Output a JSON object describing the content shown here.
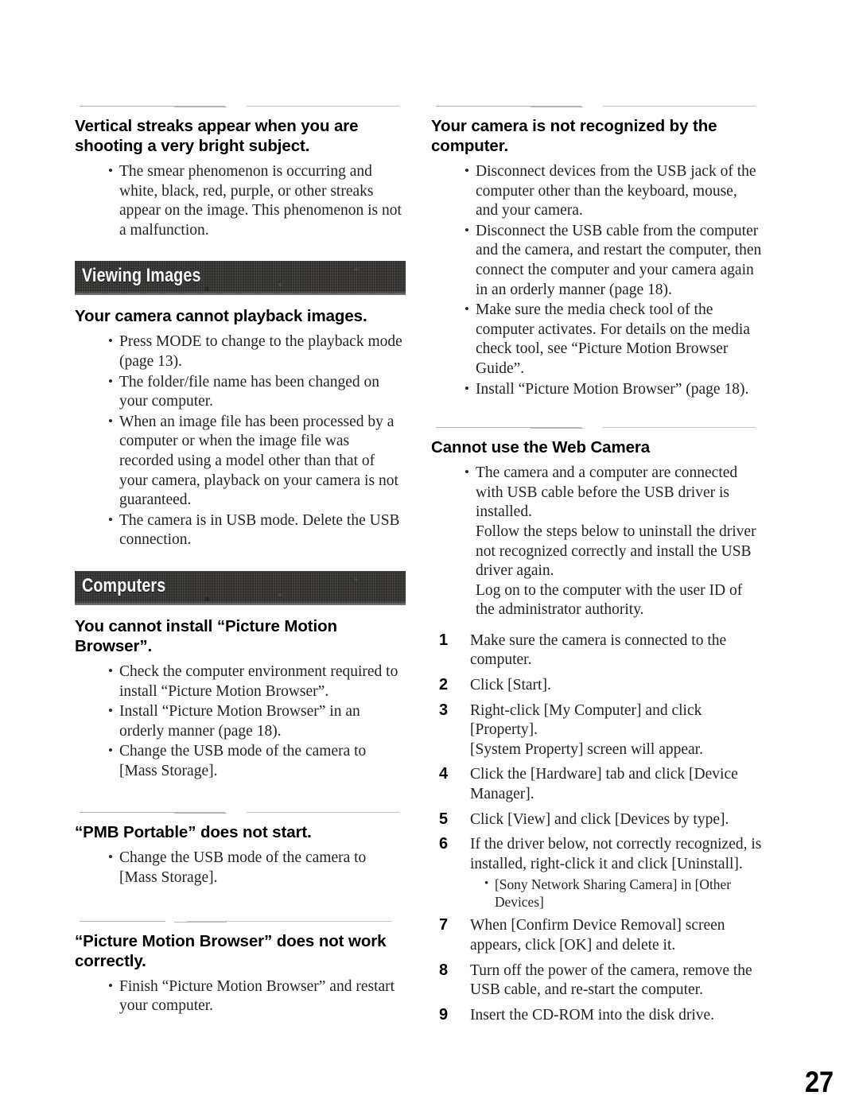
{
  "page_number": "27",
  "left_column": {
    "sections": [
      {
        "id": "vertical-streaks",
        "has_rule": true,
        "heading": "Vertical streaks appear when you are shooting a very bright subject.",
        "bullets": [
          "The smear phenomenon is occurring and white, black, red, purple, or other streaks appear on the image. This phenomenon is not a malfunction."
        ]
      }
    ],
    "banner_viewing_images": "Viewing Images",
    "viewing_images": {
      "heading": "Your camera cannot playback images.",
      "bullets": [
        "Press MODE to change to the playback mode (page 13).",
        "The folder/file name has been changed on your computer.",
        "When an image file has been processed by a computer or when the image file was recorded using a model other than that of your camera, playback on your camera is not guaranteed.",
        "The camera is in USB mode. Delete the USB connection."
      ]
    },
    "banner_computers": "Computers",
    "computers": {
      "heading": "You cannot install “Picture Motion Browser”.",
      "bullets": [
        "Check the computer environment required to install “Picture Motion Browser”.",
        "Install “Picture Motion Browser” in an orderly manner (page 18).",
        "Change the USB mode of the camera to [Mass Storage]."
      ]
    },
    "pmb_portable": {
      "heading": "“PMB Portable” does not start.",
      "bullets": [
        "Change the USB mode of the camera to [Mass Storage]."
      ]
    },
    "pmb_not_working": {
      "heading": "“Picture Motion Browser” does not work correctly.",
      "bullets": [
        "Finish “Picture Motion Browser” and restart your computer."
      ]
    }
  },
  "right_column": {
    "camera_not_recognized": {
      "heading": "Your camera is not recognized by the computer.",
      "bullets": [
        "Disconnect devices from the USB jack of the computer other than the keyboard, mouse, and your camera.",
        "Disconnect the USB cable from the computer and the camera, and restart the computer, then connect the computer and your camera again in an orderly manner (page 18).",
        "Make sure the media check tool of the computer activates. For details on the media check tool, see “Picture Motion Browser Guide”.",
        "Install “Picture Motion Browser” (page 18)."
      ]
    },
    "web_camera": {
      "heading": "Cannot use the Web Camera",
      "bullet_main": "The camera and a computer are connected with USB cable before the USB driver is installed.",
      "bullet_cont_1": "Follow the steps below to uninstall the driver not recognized correctly and install the USB driver again.",
      "bullet_cont_2": "Log on to the computer with the user ID of the administrator authority.",
      "steps": [
        {
          "num": "1",
          "text": "Make sure the camera is connected to the computer."
        },
        {
          "num": "2",
          "text": "Click [Start]."
        },
        {
          "num": "3",
          "text": "Right-click [My Computer] and click [Property].",
          "extra": "[System Property] screen will appear."
        },
        {
          "num": "4",
          "text": "Click the [Hardware] tab and click [Device Manager]."
        },
        {
          "num": "5",
          "text": "Click [View] and click [Devices by type]."
        },
        {
          "num": "6",
          "text": "If the driver below, not correctly recognized, is installed, right-click it and click [Uninstall].",
          "substeps": [
            "[Sony Network Sharing Camera] in [Other Devices]"
          ]
        },
        {
          "num": "7",
          "text": "When [Confirm Device Removal] screen appears, click [OK] and delete it."
        },
        {
          "num": "8",
          "text": "Turn off the power of the camera, remove the USB cable, and re-start the computer."
        },
        {
          "num": "9",
          "text": "Insert the CD-ROM into the disk drive."
        }
      ]
    }
  }
}
